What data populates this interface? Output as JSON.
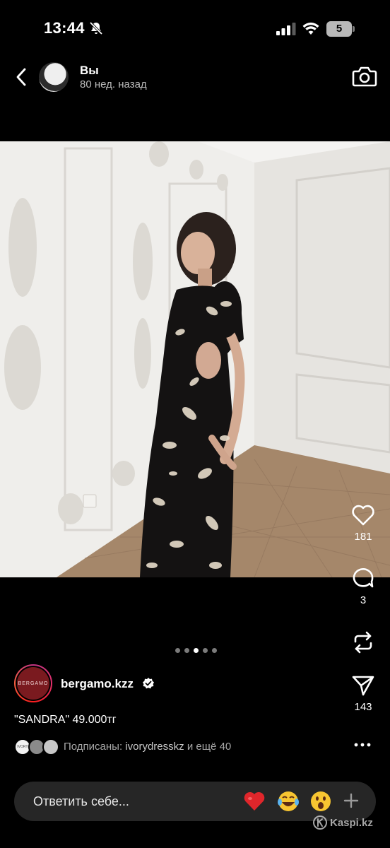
{
  "status_bar": {
    "time": "13:44",
    "battery_level": "5",
    "icons": [
      "bell-slash-icon",
      "signal-icon",
      "wifi-icon",
      "battery-icon"
    ]
  },
  "header": {
    "name": "Вы",
    "time_ago": "80 нед. назад",
    "icons": [
      "back-arrow-icon",
      "camera-icon"
    ]
  },
  "actions": {
    "likes": "181",
    "comments": "3",
    "shares": "143",
    "icons": [
      "heart-icon",
      "comment-icon",
      "repost-icon",
      "send-icon"
    ]
  },
  "carousel": {
    "total": 5,
    "active_index": 2
  },
  "post": {
    "author": "bergamo.kzz",
    "author_avatar_text": "BERGAMO",
    "caption": "\"SANDRA\" 49.000тг"
  },
  "followers": {
    "prefix": "Подписаны: ",
    "account": "ivorydresskz",
    "suffix": " и ещё 40",
    "avatar_text": "IVORY"
  },
  "reply": {
    "placeholder": "Ответить себе...",
    "emojis": [
      "❤️",
      "😂",
      "😮"
    ]
  },
  "watermark": {
    "text": "Kaspi.kz"
  },
  "colors": {
    "background": "#000000",
    "reply_bar": "#262626",
    "muted_text": "#a8a8a8",
    "verified": "#ffffff",
    "heart_emoji": "#e0262b"
  }
}
